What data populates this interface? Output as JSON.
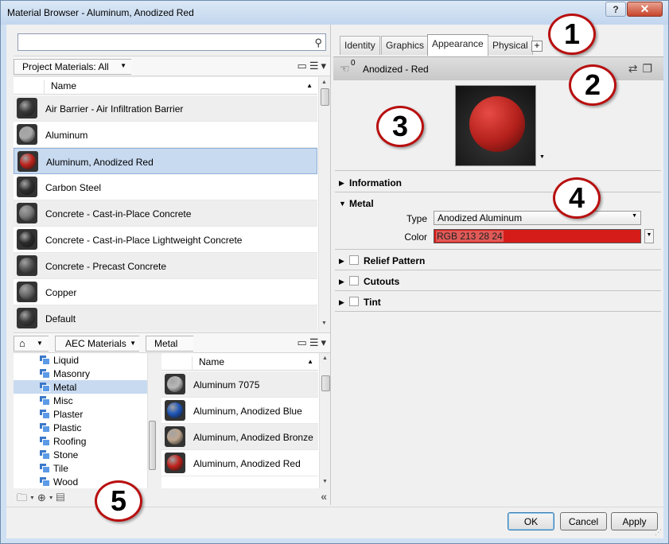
{
  "window": {
    "title": "Material Browser - Aluminum, Anodized Red",
    "help_label": "?",
    "close_label": "✕"
  },
  "search": {
    "placeholder": "",
    "value": ""
  },
  "project": {
    "filter_label": "Project Materials: All",
    "column_name": "Name",
    "materials": [
      {
        "name": "Air Barrier - Air Infiltration Barrier",
        "swatch": "#3a3a3a",
        "selected": false
      },
      {
        "name": "Aluminum",
        "swatch": "#a8a8a8",
        "selected": false
      },
      {
        "name": "Aluminum, Anodized Red",
        "swatch": "#c0221c",
        "selected": true
      },
      {
        "name": "Carbon Steel",
        "swatch": "#2f2f2f",
        "selected": false
      },
      {
        "name": "Concrete - Cast-in-Place Concrete",
        "swatch": "#7a7a7a",
        "selected": false
      },
      {
        "name": "Concrete - Cast-in-Place Lightweight Concrete",
        "swatch": "#2a2a2a",
        "selected": false
      },
      {
        "name": "Concrete - Precast Concrete",
        "swatch": "#555555",
        "selected": false
      },
      {
        "name": "Copper",
        "swatch": "#6a6a6a",
        "selected": false
      },
      {
        "name": "Default",
        "swatch": "#3a3a3a",
        "selected": false
      }
    ]
  },
  "library": {
    "breadcrumb": [
      "AEC Materials",
      "Metal"
    ],
    "tree": [
      "Liquid",
      "Masonry",
      "Metal",
      "Misc",
      "Plaster",
      "Plastic",
      "Roofing",
      "Stone",
      "Tile",
      "Wood"
    ],
    "tree_selected": "Metal",
    "column_name": "Name",
    "materials": [
      {
        "name": "Aluminum 7075",
        "swatch": "#b8b8b8"
      },
      {
        "name": "Aluminum, Anodized Blue",
        "swatch": "#1e56b8"
      },
      {
        "name": "Aluminum, Anodized Bronze",
        "swatch": "#bda58e"
      },
      {
        "name": "Aluminum, Anodized Red",
        "swatch": "#c0221c"
      }
    ]
  },
  "editor": {
    "tabs": [
      "Identity",
      "Graphics",
      "Appearance",
      "Physical"
    ],
    "active_tab": "Appearance",
    "add_tab_label": "+",
    "asset_count": "0",
    "asset_name": "Anodized - Red",
    "sections": {
      "information": "Information",
      "metal": "Metal",
      "relief": "Relief Pattern",
      "cutouts": "Cutouts",
      "tint": "Tint"
    },
    "type_label": "Type",
    "type_value": "Anodized Aluminum",
    "color_label": "Color",
    "color_value": "RGB 213 28 24",
    "color_hex": "#d51c18"
  },
  "footer": {
    "ok": "OK",
    "cancel": "Cancel",
    "apply": "Apply"
  },
  "callouts": [
    "1",
    "2",
    "3",
    "4",
    "5"
  ]
}
